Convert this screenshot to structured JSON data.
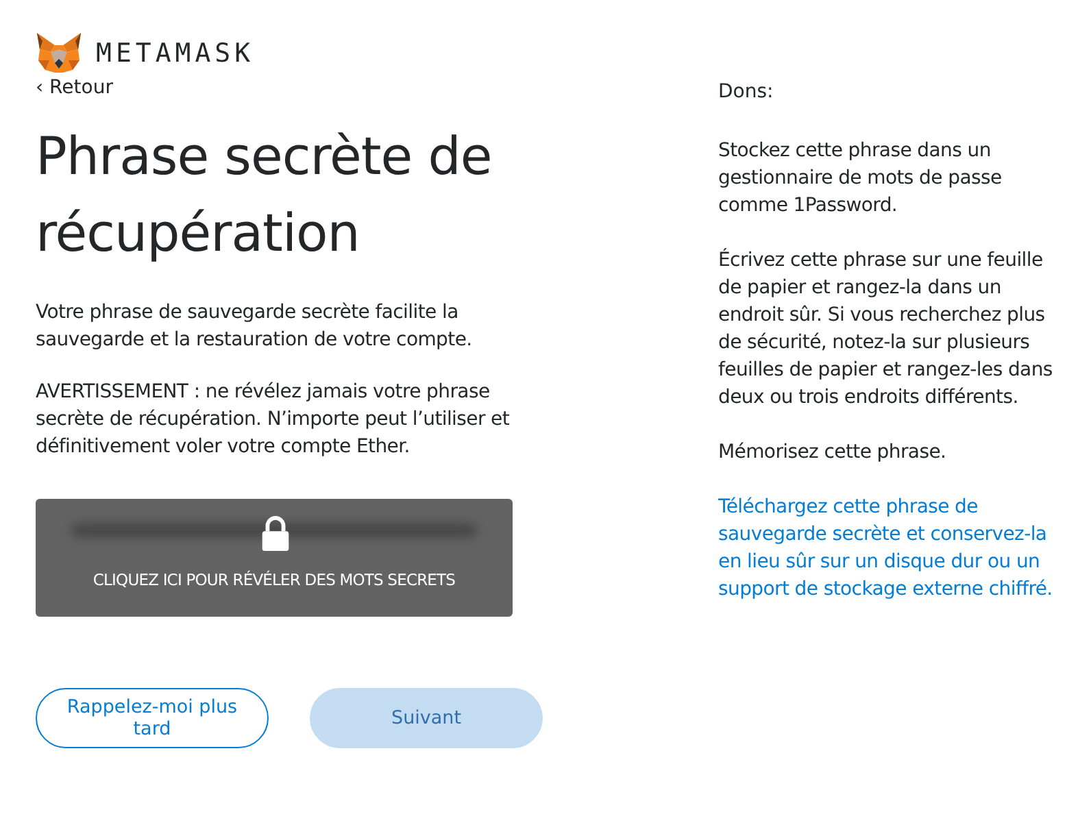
{
  "brand": {
    "name": "METAMASK"
  },
  "back_link": "‹ Retour",
  "title": "Phrase secrète de récupération",
  "paragraphs": [
    "Votre phrase de sauvegarde secrète facilite la sauvegarde et la restauration de votre compte.",
    "AVERTISSEMENT : ne révélez jamais votre phrase secrète de récupération. N’importe peut l’utiliser et définitivement voler votre compte Ether."
  ],
  "reveal": {
    "label": "CLIQUEZ ICI POUR RÉVÉLER DES MOTS SECRETS",
    "revealed": false
  },
  "buttons": [
    {
      "label": "Rappelez-moi plus tard",
      "kind": "secondary",
      "disabled": false
    },
    {
      "label": "Suivant",
      "kind": "primary",
      "disabled": true
    }
  ],
  "tips": {
    "heading": "Dons:",
    "items": [
      {
        "kind": "text",
        "text": "Stockez cette phrase dans un gestionnaire de mots de passe comme 1Password."
      },
      {
        "kind": "text",
        "text": "Écrivez cette phrase sur une feuille de papier et rangez-la dans un endroit sûr. Si vous recherchez plus de sécurité, notez-la sur plusieurs feuilles de papier et rangez-les dans deux ou trois endroits différents."
      },
      {
        "kind": "text",
        "text": "Mémorisez cette phrase."
      },
      {
        "kind": "link",
        "text": "Téléchargez cette phrase de sauvegarde secrète et conservez-la en lieu sûr sur un disque dur ou un support de stockage externe chiffré."
      }
    ]
  }
}
